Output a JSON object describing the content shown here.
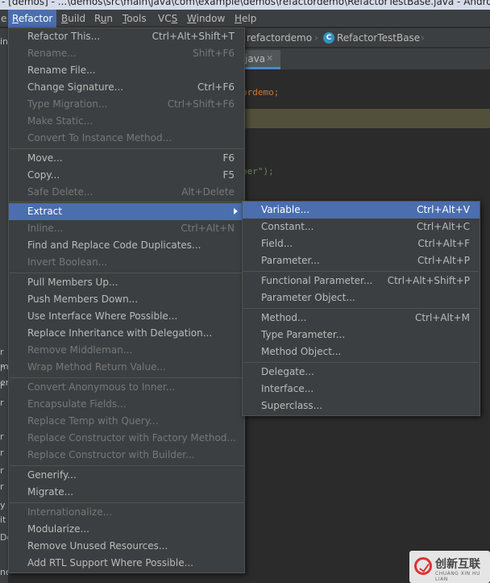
{
  "window": {
    "title": "- [demos] - ...\\demos\\src\\main\\java\\com\\example\\demos\\refactordemo\\RefactorTestBase.java - Android"
  },
  "menubar": {
    "items": [
      {
        "pre": "",
        "u": "R",
        "post": "efactor"
      },
      {
        "pre": "",
        "u": "B",
        "post": "uild"
      },
      {
        "pre": "R",
        "u": "u",
        "post": "n"
      },
      {
        "pre": "",
        "u": "T",
        "post": "ools"
      },
      {
        "pre": "VC",
        "u": "S",
        "post": ""
      },
      {
        "pre": "",
        "u": "W",
        "post": "indow"
      },
      {
        "pre": "",
        "u": "H",
        "post": "elp"
      }
    ]
  },
  "navbar": {
    "crumb1": "refactordemo",
    "class_badge": "C",
    "crumb2": "RefactorTestBase"
  },
  "editor_tab": {
    "label": "java",
    "close": "✕"
  },
  "code": {
    "line1": "ordemo;",
    "line2": ".",
    "line3": "per\");"
  },
  "left_fragments": [
    "in",
    "r",
    "r",
    "r",
    "r",
    "m",
    "er",
    "r",
    "r",
    "r",
    "r",
    "y",
    "it",
    "De",
    "nc"
  ],
  "refactor_menu": {
    "items": [
      {
        "label": "Refactor This...",
        "shortcut": "Ctrl+Alt+Shift+T",
        "enabled": true
      },
      {
        "label": "Rename...",
        "shortcut": "Shift+F6",
        "enabled": false
      },
      {
        "label": "Rename File...",
        "shortcut": "",
        "enabled": true
      },
      {
        "label": "Change Signature...",
        "shortcut": "Ctrl+F6",
        "enabled": true
      },
      {
        "label": "Type Migration...",
        "shortcut": "Ctrl+Shift+F6",
        "enabled": false
      },
      {
        "label": "Make Static...",
        "shortcut": "",
        "enabled": false
      },
      {
        "label": "Convert To Instance Method...",
        "shortcut": "",
        "enabled": false
      },
      {
        "label": "Move...",
        "shortcut": "F6",
        "enabled": true
      },
      {
        "label": "Copy...",
        "shortcut": "F5",
        "enabled": true
      },
      {
        "label": "Safe Delete...",
        "shortcut": "Alt+Delete",
        "enabled": false
      },
      {
        "label": "Extract",
        "shortcut": "",
        "enabled": true,
        "selected": true,
        "submenu": true
      },
      {
        "label": "Inline...",
        "shortcut": "Ctrl+Alt+N",
        "enabled": false
      },
      {
        "label": "Find and Replace Code Duplicates...",
        "shortcut": "",
        "enabled": true
      },
      {
        "label": "Invert Boolean...",
        "shortcut": "",
        "enabled": false
      },
      {
        "label": "Pull Members Up...",
        "shortcut": "",
        "enabled": true
      },
      {
        "label": "Push Members Down...",
        "shortcut": "",
        "enabled": true
      },
      {
        "label": "Use Interface Where Possible...",
        "shortcut": "",
        "enabled": true
      },
      {
        "label": "Replace Inheritance with Delegation...",
        "shortcut": "",
        "enabled": true
      },
      {
        "label": "Remove Middleman...",
        "shortcut": "",
        "enabled": false
      },
      {
        "label": "Wrap Method Return Value...",
        "shortcut": "",
        "enabled": false
      },
      {
        "label": "Convert Anonymous to Inner...",
        "shortcut": "",
        "enabled": false
      },
      {
        "label": "Encapsulate Fields...",
        "shortcut": "",
        "enabled": false
      },
      {
        "label": "Replace Temp with Query...",
        "shortcut": "",
        "enabled": false
      },
      {
        "label": "Replace Constructor with Factory Method...",
        "shortcut": "",
        "enabled": false
      },
      {
        "label": "Replace Constructor with Builder...",
        "shortcut": "",
        "enabled": false
      },
      {
        "label": "Generify...",
        "shortcut": "",
        "enabled": true
      },
      {
        "label": "Migrate...",
        "shortcut": "",
        "enabled": true
      },
      {
        "label": "Internationalize...",
        "shortcut": "",
        "enabled": false
      },
      {
        "label": "Modularize...",
        "shortcut": "",
        "enabled": true
      },
      {
        "label": "Remove Unused Resources...",
        "shortcut": "",
        "enabled": true
      },
      {
        "label": "Add RTL Support Where Possible...",
        "shortcut": "",
        "enabled": true
      }
    ]
  },
  "extract_menu": {
    "items": [
      {
        "label": "Variable...",
        "shortcut": "Ctrl+Alt+V",
        "selected": true
      },
      {
        "label": "Constant...",
        "shortcut": "Ctrl+Alt+C"
      },
      {
        "label": "Field...",
        "shortcut": "Ctrl+Alt+F"
      },
      {
        "label": "Parameter...",
        "shortcut": "Ctrl+Alt+P"
      },
      {
        "label": "Functional Parameter...",
        "shortcut": "Ctrl+Alt+Shift+P"
      },
      {
        "label": "Parameter Object...",
        "shortcut": ""
      },
      {
        "label": "Method...",
        "shortcut": "Ctrl+Alt+M"
      },
      {
        "label": "Type Parameter...",
        "shortcut": ""
      },
      {
        "label": "Method Object...",
        "shortcut": ""
      },
      {
        "label": "Delegate...",
        "shortcut": ""
      },
      {
        "label": "Interface...",
        "shortcut": ""
      },
      {
        "label": "Superclass...",
        "shortcut": ""
      }
    ]
  },
  "watermark": {
    "text": "创新互联",
    "sub": "CHUANG XIN HU LIAN"
  },
  "colors": {
    "menu_bg": "#3c3f41",
    "selection": "#4b6eaf",
    "editor_bg": "#2b2b2b",
    "disabled_text": "#777777"
  }
}
